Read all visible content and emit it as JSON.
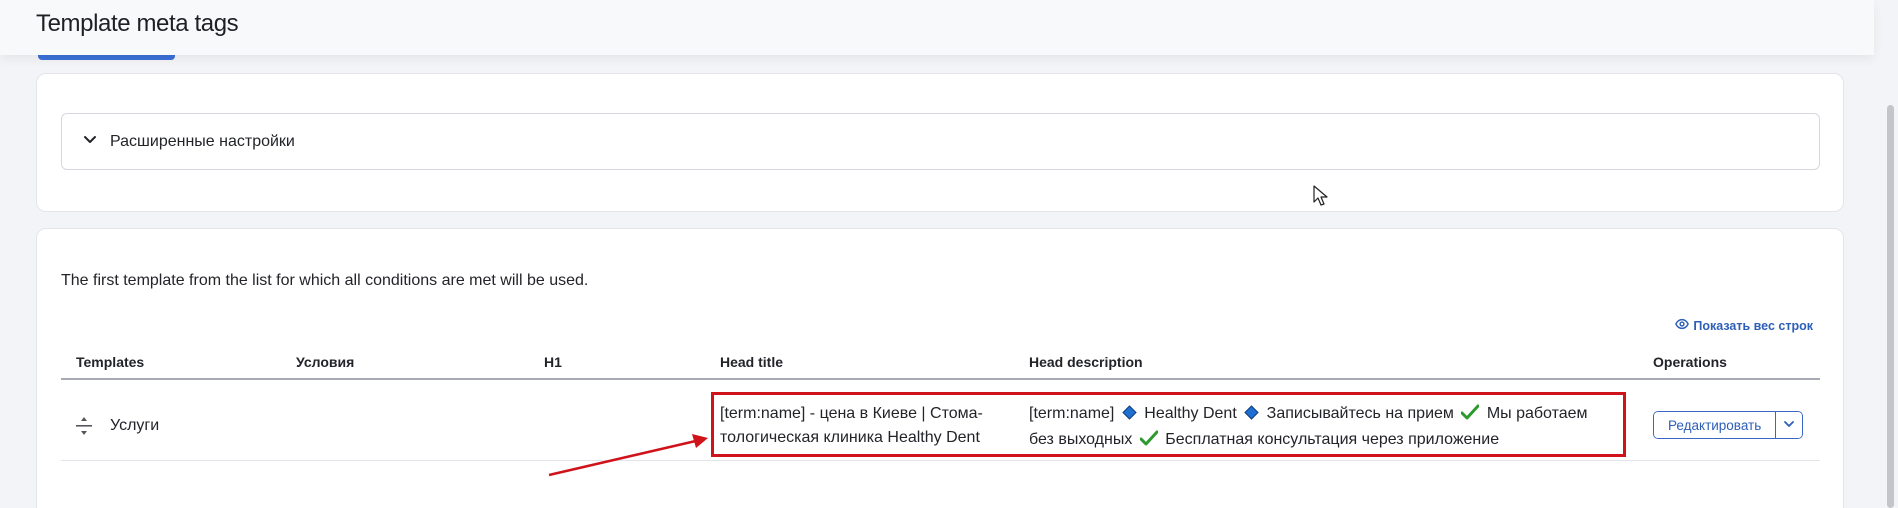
{
  "page": {
    "title": "Template meta tags"
  },
  "advanced": {
    "label": "Расширенные настройки"
  },
  "templates": {
    "intro": "The first template from the list for which all conditions are met will be used.",
    "show_weights": "Показать вес строк",
    "columns": {
      "templates": "Templates",
      "conditions": "Условия",
      "h1": "H1",
      "head_title": "Head title",
      "head_description": "Head description",
      "operations": "Operations"
    },
    "rows": [
      {
        "name": "Услуги",
        "conditions": "",
        "h1": "",
        "head_title_line1": "[term:name] - цена в Киеве | Стома-",
        "head_title_line2": "тологическая клиника Healthy Dent",
        "desc_part1": "[term:name]",
        "desc_part2": "Healthy Dent",
        "desc_part3": "Записывайтесь на прием",
        "desc_part4": "Мы работаем",
        "desc_part5": "без выходных",
        "desc_part6": "Бесплатная консультация через приложение",
        "edit_label": "Редактировать"
      }
    ]
  },
  "colors": {
    "accent": "#2e5fb8",
    "highlight": "#d0121b",
    "diamond": "#1f6fd1",
    "check": "#2e9a2e"
  }
}
